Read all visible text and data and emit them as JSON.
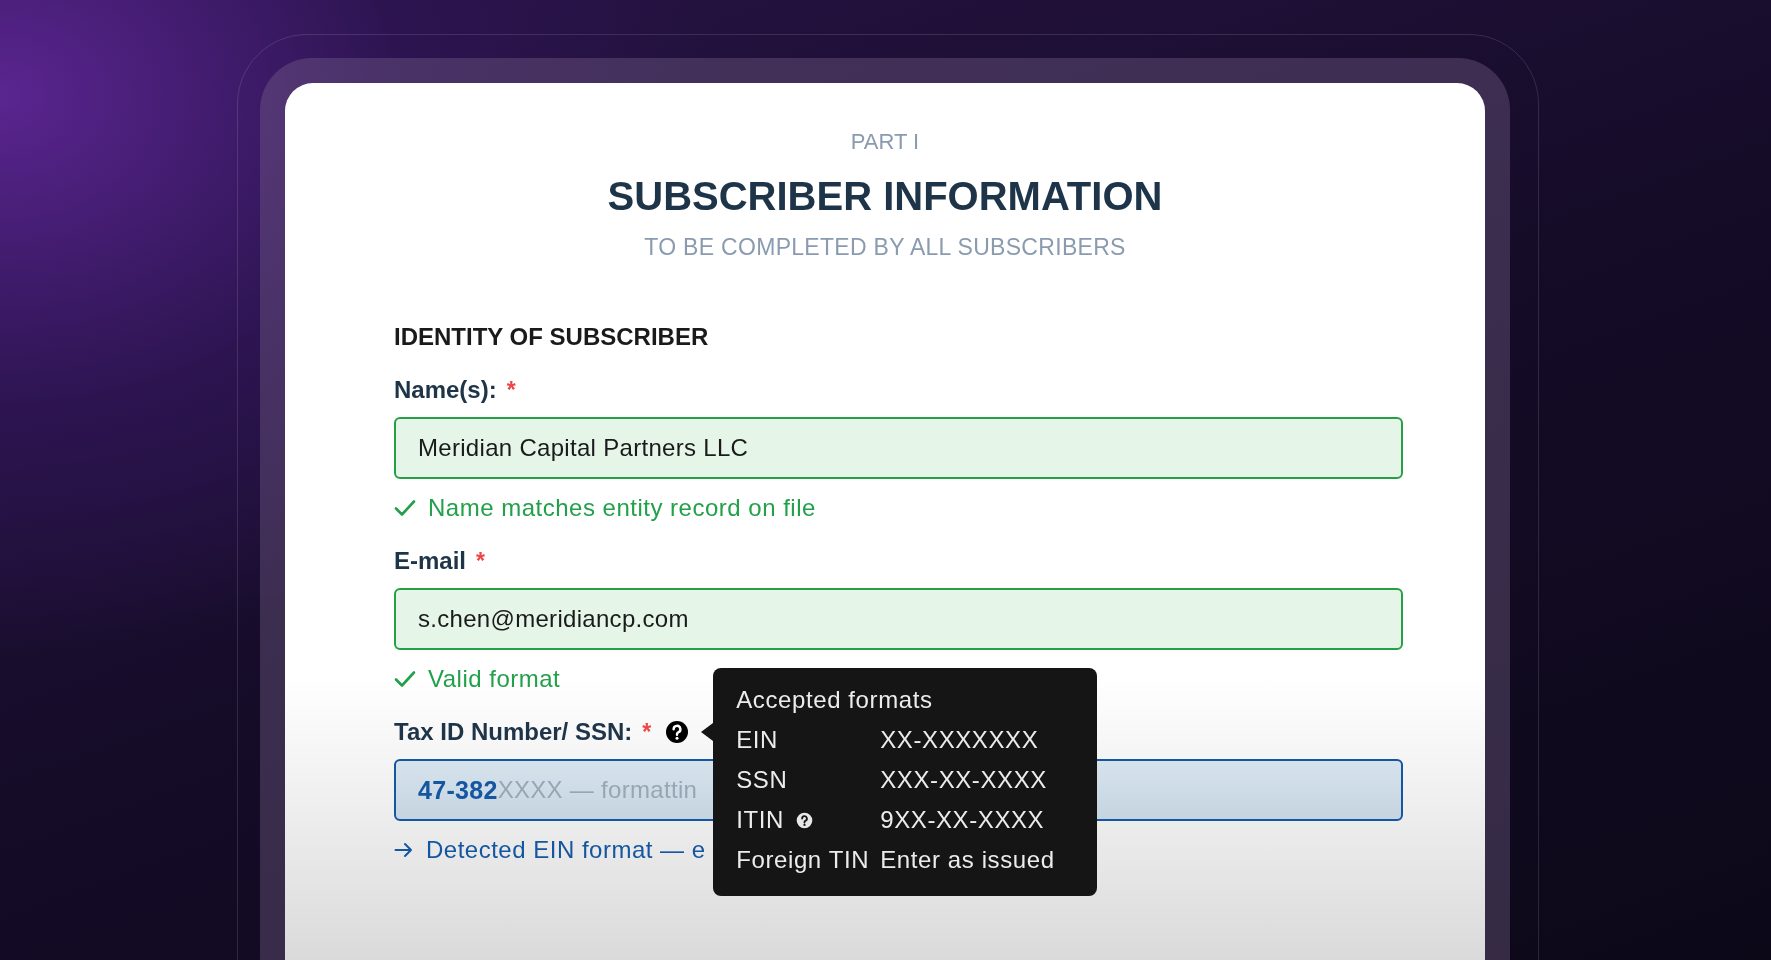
{
  "header": {
    "part": "PART I",
    "title": "SUBSCRIBER INFORMATION",
    "subtitle": "TO BE COMPLETED BY ALL SUBSCRIBERS"
  },
  "section": {
    "title": "IDENTITY OF SUBSCRIBER"
  },
  "fields": [
    {
      "label": "Name(s):",
      "required_mark": "*",
      "help": false,
      "valid": true,
      "focused": false,
      "value": "Meridian Capital Partners LLC",
      "message": {
        "kind": "success",
        "text": "Name matches entity record on file"
      }
    },
    {
      "label": "E-mail",
      "required_mark": "*",
      "help": false,
      "valid": true,
      "focused": false,
      "value": "s.chen@meridiancp.com",
      "message": {
        "kind": "success",
        "text": "Valid format"
      }
    },
    {
      "label": "Tax ID Number/ SSN:",
      "required_mark": "*",
      "help": true,
      "valid": false,
      "focused": true,
      "value": "47-382",
      "placeholder": "XXXX — formattin",
      "message": {
        "kind": "info",
        "text": "Detected EIN format — e"
      }
    }
  ],
  "tooltip": {
    "title": "Accepted formats",
    "rows": [
      {
        "label": "EIN",
        "help": false,
        "value": "XX-XXXXXXX"
      },
      {
        "label": "SSN",
        "help": false,
        "value": "XXX-XX-XXXX"
      },
      {
        "label": "ITIN",
        "help": true,
        "value": "9XX-XX-XXXX"
      },
      {
        "label": "Foreign TIN",
        "help": false,
        "value": "Enter as issued"
      }
    ]
  }
}
